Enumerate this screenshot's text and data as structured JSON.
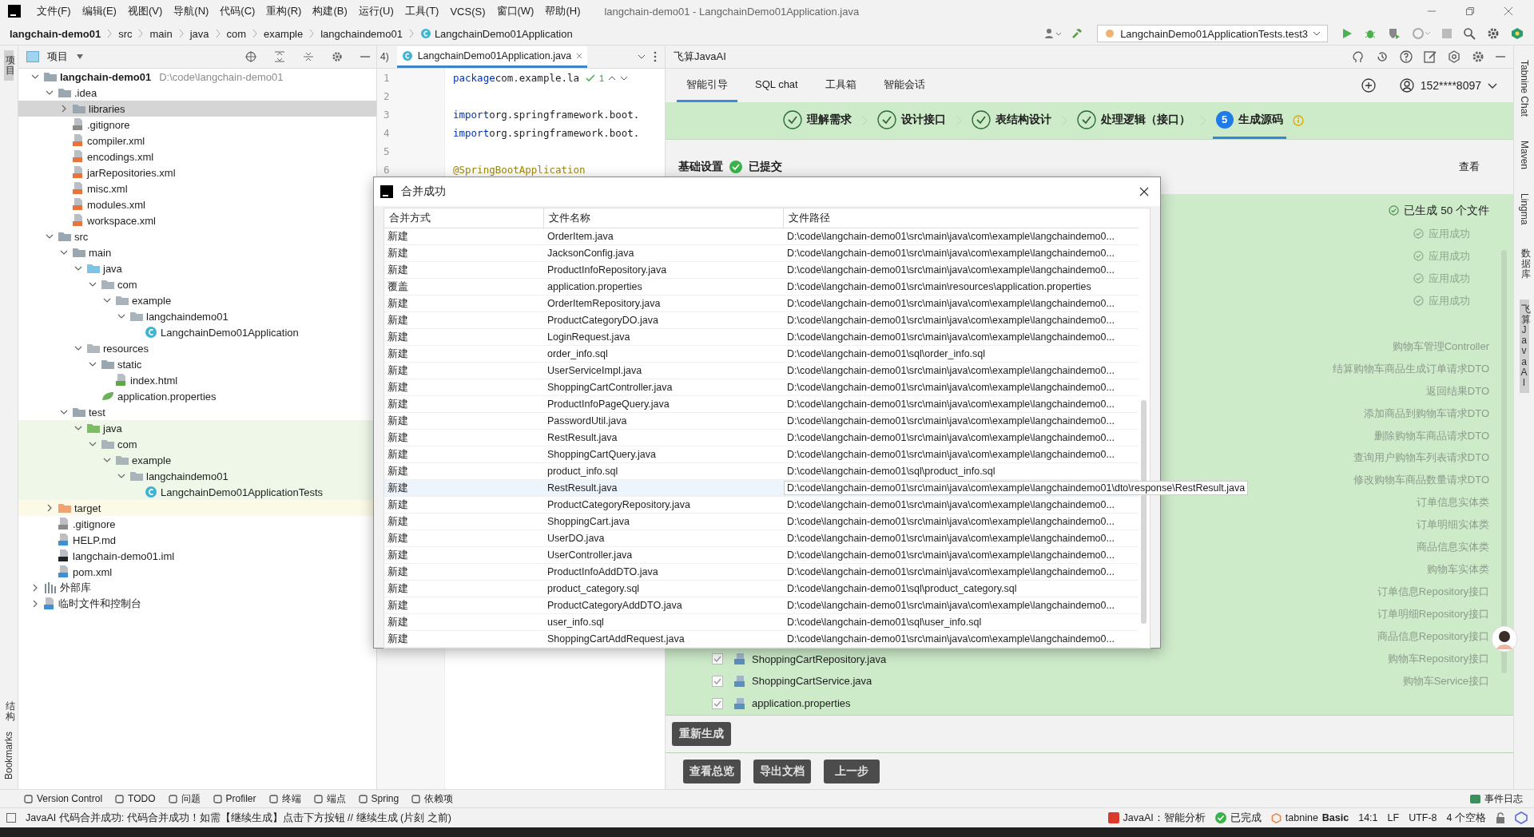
{
  "menu": [
    "文件(F)",
    "编辑(E)",
    "视图(V)",
    "导航(N)",
    "代码(C)",
    "重构(R)",
    "构建(B)",
    "运行(U)",
    "工具(T)",
    "VCS(S)",
    "窗口(W)",
    "帮助(H)"
  ],
  "window": {
    "title": "langchain-demo01 - LangchainDemo01Application.java"
  },
  "breadcrumbs": [
    "langchain-demo01",
    "src",
    "main",
    "java",
    "com",
    "example",
    "langchaindemo01",
    "LangchainDemo01Application"
  ],
  "run_config": "LangchainDemo01ApplicationTests.test3",
  "left_stripe": {
    "top": [
      {
        "label": "项目",
        "kind": "stacked",
        "selected": true
      }
    ],
    "bottom": [
      {
        "label": "结构",
        "kind": "stacked",
        "selected": false
      },
      {
        "label": "Bookmarks",
        "kind": "rotated",
        "selected": false
      }
    ]
  },
  "right_stripe": [
    {
      "label": "Tabnine Chat",
      "kind": "rotated",
      "selected": false
    },
    {
      "label": "Maven",
      "kind": "rotated",
      "selected": false
    },
    {
      "label": "Lingma",
      "kind": "rotated",
      "selected": false
    },
    {
      "label": "数据库",
      "kind": "stacked",
      "selected": false
    },
    {
      "label": "飞算JavaAI",
      "kind": "stacked",
      "selected": true
    }
  ],
  "project": {
    "title": "项目",
    "tree": [
      {
        "label": "langchain-demo01",
        "path": "D:\\code\\langchain-demo01",
        "kind": "module",
        "expanded": true,
        "selected": false,
        "children": [
          {
            "label": ".idea",
            "kind": "folder",
            "expanded": true,
            "selected": false,
            "children": [
              {
                "label": "libraries",
                "kind": "folder",
                "expanded": false,
                "selected": true
              },
              {
                "label": ".gitignore",
                "kind": "ignore",
                "selected": false
              },
              {
                "label": "compiler.xml",
                "kind": "xml",
                "selected": false
              },
              {
                "label": "encodings.xml",
                "kind": "xml",
                "selected": false
              },
              {
                "label": "jarRepositories.xml",
                "kind": "xml",
                "selected": false
              },
              {
                "label": "misc.xml",
                "kind": "xml",
                "selected": false
              },
              {
                "label": "modules.xml",
                "kind": "xml",
                "selected": false
              },
              {
                "label": "workspace.xml",
                "kind": "xml",
                "selected": false
              }
            ]
          },
          {
            "label": "src",
            "kind": "folder",
            "expanded": true,
            "selected": false,
            "children": [
              {
                "label": "main",
                "kind": "folder",
                "expanded": true,
                "selected": false,
                "children": [
                  {
                    "label": "java",
                    "kind": "source",
                    "expanded": true,
                    "selected": false,
                    "children": [
                      {
                        "label": "com",
                        "kind": "package",
                        "expanded": true,
                        "selected": false,
                        "children": [
                          {
                            "label": "example",
                            "kind": "package",
                            "expanded": true,
                            "selected": false,
                            "children": [
                              {
                                "label": "langchaindemo01",
                                "kind": "package",
                                "expanded": true,
                                "selected": false,
                                "children": [
                                  {
                                    "label": "LangchainDemo01Application",
                                    "kind": "class",
                                    "selected": false
                                  }
                                ]
                              }
                            ]
                          }
                        ]
                      }
                    ]
                  },
                  {
                    "label": "resources",
                    "kind": "resources",
                    "expanded": true,
                    "selected": false,
                    "children": [
                      {
                        "label": "static",
                        "kind": "folder",
                        "expanded": true,
                        "selected": false,
                        "children": [
                          {
                            "label": "index.html",
                            "kind": "html",
                            "selected": false
                          }
                        ]
                      },
                      {
                        "label": "application.properties",
                        "kind": "properties",
                        "selected": false
                      }
                    ]
                  }
                ]
              },
              {
                "label": "test",
                "kind": "folder",
                "expanded": true,
                "selected": false,
                "children": [
                  {
                    "label": "java",
                    "kind": "test",
                    "color": "#eef7e8",
                    "expanded": true,
                    "selected": false,
                    "children": [
                      {
                        "label": "com",
                        "kind": "package",
                        "color": "#eef7e8",
                        "expanded": true,
                        "selected": false,
                        "children": [
                          {
                            "label": "example",
                            "kind": "package",
                            "color": "#eef7e8",
                            "expanded": true,
                            "selected": false,
                            "children": [
                              {
                                "label": "langchaindemo01",
                                "kind": "package",
                                "color": "#eef7e8",
                                "expanded": true,
                                "selected": false,
                                "children": [
                                  {
                                    "label": "LangchainDemo01ApplicationTests",
                                    "kind": "class",
                                    "color": "#eef7e8",
                                    "selected": false
                                  }
                                ]
                              }
                            ]
                          }
                        ]
                      }
                    ]
                  }
                ]
              }
            ]
          },
          {
            "label": "target",
            "kind": "excluded",
            "color": "#fcf9e6",
            "expanded": false,
            "selected": false
          },
          {
            "label": ".gitignore",
            "kind": "ignore",
            "selected": false
          },
          {
            "label": "HELP.md",
            "kind": "md",
            "selected": false
          },
          {
            "label": "langchain-demo01.iml",
            "kind": "iml",
            "selected": false
          },
          {
            "label": "pom.xml",
            "kind": "maven",
            "selected": false
          }
        ]
      },
      {
        "label": "外部库",
        "kind": "library",
        "expanded": false,
        "selected": false
      },
      {
        "label": "临时文件和控制台",
        "kind": "scratch",
        "expanded": false,
        "selected": false
      }
    ]
  },
  "editor": {
    "previous_tab": "4)",
    "tab": "LangchainDemo01Application.java",
    "inspection_count": "1",
    "lines": [
      {
        "number": "1",
        "keyword": "package",
        "code": "com.example.la"
      },
      {
        "number": "2"
      },
      {
        "number": "3",
        "keyword": "import",
        "code": "org.springframework.boot."
      },
      {
        "number": "4",
        "keyword": "import",
        "code": "org.springframework.boot."
      },
      {
        "number": "5"
      },
      {
        "number": "6",
        "annotation": "@SpringBootApplication"
      }
    ]
  },
  "ai": {
    "title": "飞算JavaAI",
    "tabs": [
      {
        "label": "智能引导",
        "selected": true
      },
      {
        "label": "SQL chat",
        "selected": false
      },
      {
        "label": "工具箱",
        "selected": false
      },
      {
        "label": "智能会话",
        "selected": false
      }
    ],
    "account": "152****8097",
    "steps": [
      {
        "label": "理解需求",
        "done": true,
        "selected": false
      },
      {
        "label": "设计接口",
        "done": true,
        "selected": false
      },
      {
        "label": "表结构设计",
        "done": true,
        "selected": false
      },
      {
        "label": "处理逻辑（接口）",
        "done": true,
        "selected": false
      },
      {
        "number": "5",
        "label": "生成源码",
        "done": false,
        "selected": true
      }
    ],
    "section": {
      "title": "基础设置",
      "status": "已提交",
      "action": "查看"
    },
    "summary": "已生成 50 个文件",
    "status_rows": [
      "应用成功",
      "应用成功",
      "应用成功",
      "应用成功"
    ],
    "file_rows": [
      {
        "description": "购物车管理Controller"
      },
      {
        "description": "结算购物车商品生成订单请求DTO"
      },
      {
        "description": "返回结果DTO"
      },
      {
        "description": "添加商品到购物车请求DTO"
      },
      {
        "description": "删除购物车商品请求DTO"
      },
      {
        "description": "查询用户购物车列表请求DTO"
      },
      {
        "description": "修改购物车商品数量请求DTO"
      },
      {
        "description": "订单信息实体类"
      },
      {
        "description": "订单明细实体类"
      },
      {
        "description": "商品信息实体类"
      },
      {
        "description": "购物车实体类"
      },
      {
        "description": "订单信息Repository接口"
      },
      {
        "description": "订单明细Repository接口"
      },
      {
        "description": "商品信息Repository接口"
      },
      {
        "name": "ShoppingCartRepository.java",
        "checked": true,
        "description": "购物车Repository接口"
      },
      {
        "name": "ShoppingCartService.java",
        "checked": true,
        "description": "购物车Service接口"
      },
      {
        "name": "application.properties",
        "checked": true
      }
    ],
    "regenerate": "重新生成",
    "footer_buttons": [
      "查看总览",
      "导出文档",
      "上一步"
    ]
  },
  "dialog": {
    "title": "合并成功",
    "columns": [
      "合并方式",
      "文件名称",
      "文件路径"
    ],
    "rows": [
      {
        "mode": "新建",
        "name": "OrderItem.java",
        "path": "D:\\code\\langchain-demo01\\src\\main\\java\\com\\example\\langchaindemo0...",
        "selected": false
      },
      {
        "mode": "新建",
        "name": "JacksonConfig.java",
        "path": "D:\\code\\langchain-demo01\\src\\main\\java\\com\\example\\langchaindemo0...",
        "selected": false
      },
      {
        "mode": "新建",
        "name": "ProductInfoRepository.java",
        "path": "D:\\code\\langchain-demo01\\src\\main\\java\\com\\example\\langchaindemo0...",
        "selected": false
      },
      {
        "mode": "覆盖",
        "name": "application.properties",
        "path": "D:\\code\\langchain-demo01\\src\\main\\resources\\application.properties",
        "selected": false
      },
      {
        "mode": "新建",
        "name": "OrderItemRepository.java",
        "path": "D:\\code\\langchain-demo01\\src\\main\\java\\com\\example\\langchaindemo0...",
        "selected": false
      },
      {
        "mode": "新建",
        "name": "ProductCategoryDO.java",
        "path": "D:\\code\\langchain-demo01\\src\\main\\java\\com\\example\\langchaindemo0...",
        "selected": false
      },
      {
        "mode": "新建",
        "name": "LoginRequest.java",
        "path": "D:\\code\\langchain-demo01\\src\\main\\java\\com\\example\\langchaindemo0...",
        "selected": false
      },
      {
        "mode": "新建",
        "name": "order_info.sql",
        "path": "D:\\code\\langchain-demo01\\sql\\order_info.sql",
        "selected": false
      },
      {
        "mode": "新建",
        "name": "UserServiceImpl.java",
        "path": "D:\\code\\langchain-demo01\\src\\main\\java\\com\\example\\langchaindemo0...",
        "selected": false
      },
      {
        "mode": "新建",
        "name": "ShoppingCartController.java",
        "path": "D:\\code\\langchain-demo01\\src\\main\\java\\com\\example\\langchaindemo0...",
        "selected": false
      },
      {
        "mode": "新建",
        "name": "ProductInfoPageQuery.java",
        "path": "D:\\code\\langchain-demo01\\src\\main\\java\\com\\example\\langchaindemo0...",
        "selected": false
      },
      {
        "mode": "新建",
        "name": "PasswordUtil.java",
        "path": "D:\\code\\langchain-demo01\\src\\main\\java\\com\\example\\langchaindemo0...",
        "selected": false
      },
      {
        "mode": "新建",
        "name": "RestResult.java",
        "path": "D:\\code\\langchain-demo01\\src\\main\\java\\com\\example\\langchaindemo0...",
        "selected": false
      },
      {
        "mode": "新建",
        "name": "ShoppingCartQuery.java",
        "path": "D:\\code\\langchain-demo01\\src\\main\\java\\com\\example\\langchaindemo0...",
        "selected": false
      },
      {
        "mode": "新建",
        "name": "product_info.sql",
        "path": "D:\\code\\langchain-demo01\\sql\\product_info.sql",
        "selected": false
      },
      {
        "mode": "新建",
        "name": "RestResult.java",
        "path": "D:\\code\\langchain-demo01\\src\\main\\java\\com\\example\\langchaindemo01\\dto\\response\\RestResult.java",
        "selected": true
      },
      {
        "mode": "新建",
        "name": "ProductCategoryRepository.java",
        "path": "D:\\code\\langchain-demo01\\src\\main\\java\\com\\example\\langchaindemo0...",
        "selected": false
      },
      {
        "mode": "新建",
        "name": "ShoppingCart.java",
        "path": "D:\\code\\langchain-demo01\\src\\main\\java\\com\\example\\langchaindemo0...",
        "selected": false
      },
      {
        "mode": "新建",
        "name": "UserDO.java",
        "path": "D:\\code\\langchain-demo01\\src\\main\\java\\com\\example\\langchaindemo0...",
        "selected": false
      },
      {
        "mode": "新建",
        "name": "UserController.java",
        "path": "D:\\code\\langchain-demo01\\src\\main\\java\\com\\example\\langchaindemo0...",
        "selected": false
      },
      {
        "mode": "新建",
        "name": "ProductInfoAddDTO.java",
        "path": "D:\\code\\langchain-demo01\\src\\main\\java\\com\\example\\langchaindemo0...",
        "selected": false
      },
      {
        "mode": "新建",
        "name": "product_category.sql",
        "path": "D:\\code\\langchain-demo01\\sql\\product_category.sql",
        "selected": false
      },
      {
        "mode": "新建",
        "name": "ProductCategoryAddDTO.java",
        "path": "D:\\code\\langchain-demo01\\src\\main\\java\\com\\example\\langchaindemo0...",
        "selected": false
      },
      {
        "mode": "新建",
        "name": "user_info.sql",
        "path": "D:\\code\\langchain-demo01\\sql\\user_info.sql",
        "selected": false
      },
      {
        "mode": "新建",
        "name": "ShoppingCartAddRequest.java",
        "path": "D:\\code\\langchain-demo01\\src\\main\\java\\com\\example\\langchaindemo0...",
        "selected": false
      }
    ]
  },
  "tool_windows": [
    "Version Control",
    "TODO",
    "问题",
    "Profiler",
    "终端",
    "端点",
    "Spring",
    "依赖项"
  ],
  "event_log": "事件日志",
  "status_bar": {
    "message": "JavaAI 代码合并成功: 代码合并成功！如需【继续生成】点击下方按钮 // 继续生成 (片刻 之前)",
    "ai": "JavaAI：智能分析",
    "ai_state": "已完成",
    "tabnine": "tabnine",
    "tabnine_plan": "Basic",
    "position": "14:1",
    "line_ending": "LF",
    "encoding": "UTF-8",
    "indent": "4 个空格"
  }
}
